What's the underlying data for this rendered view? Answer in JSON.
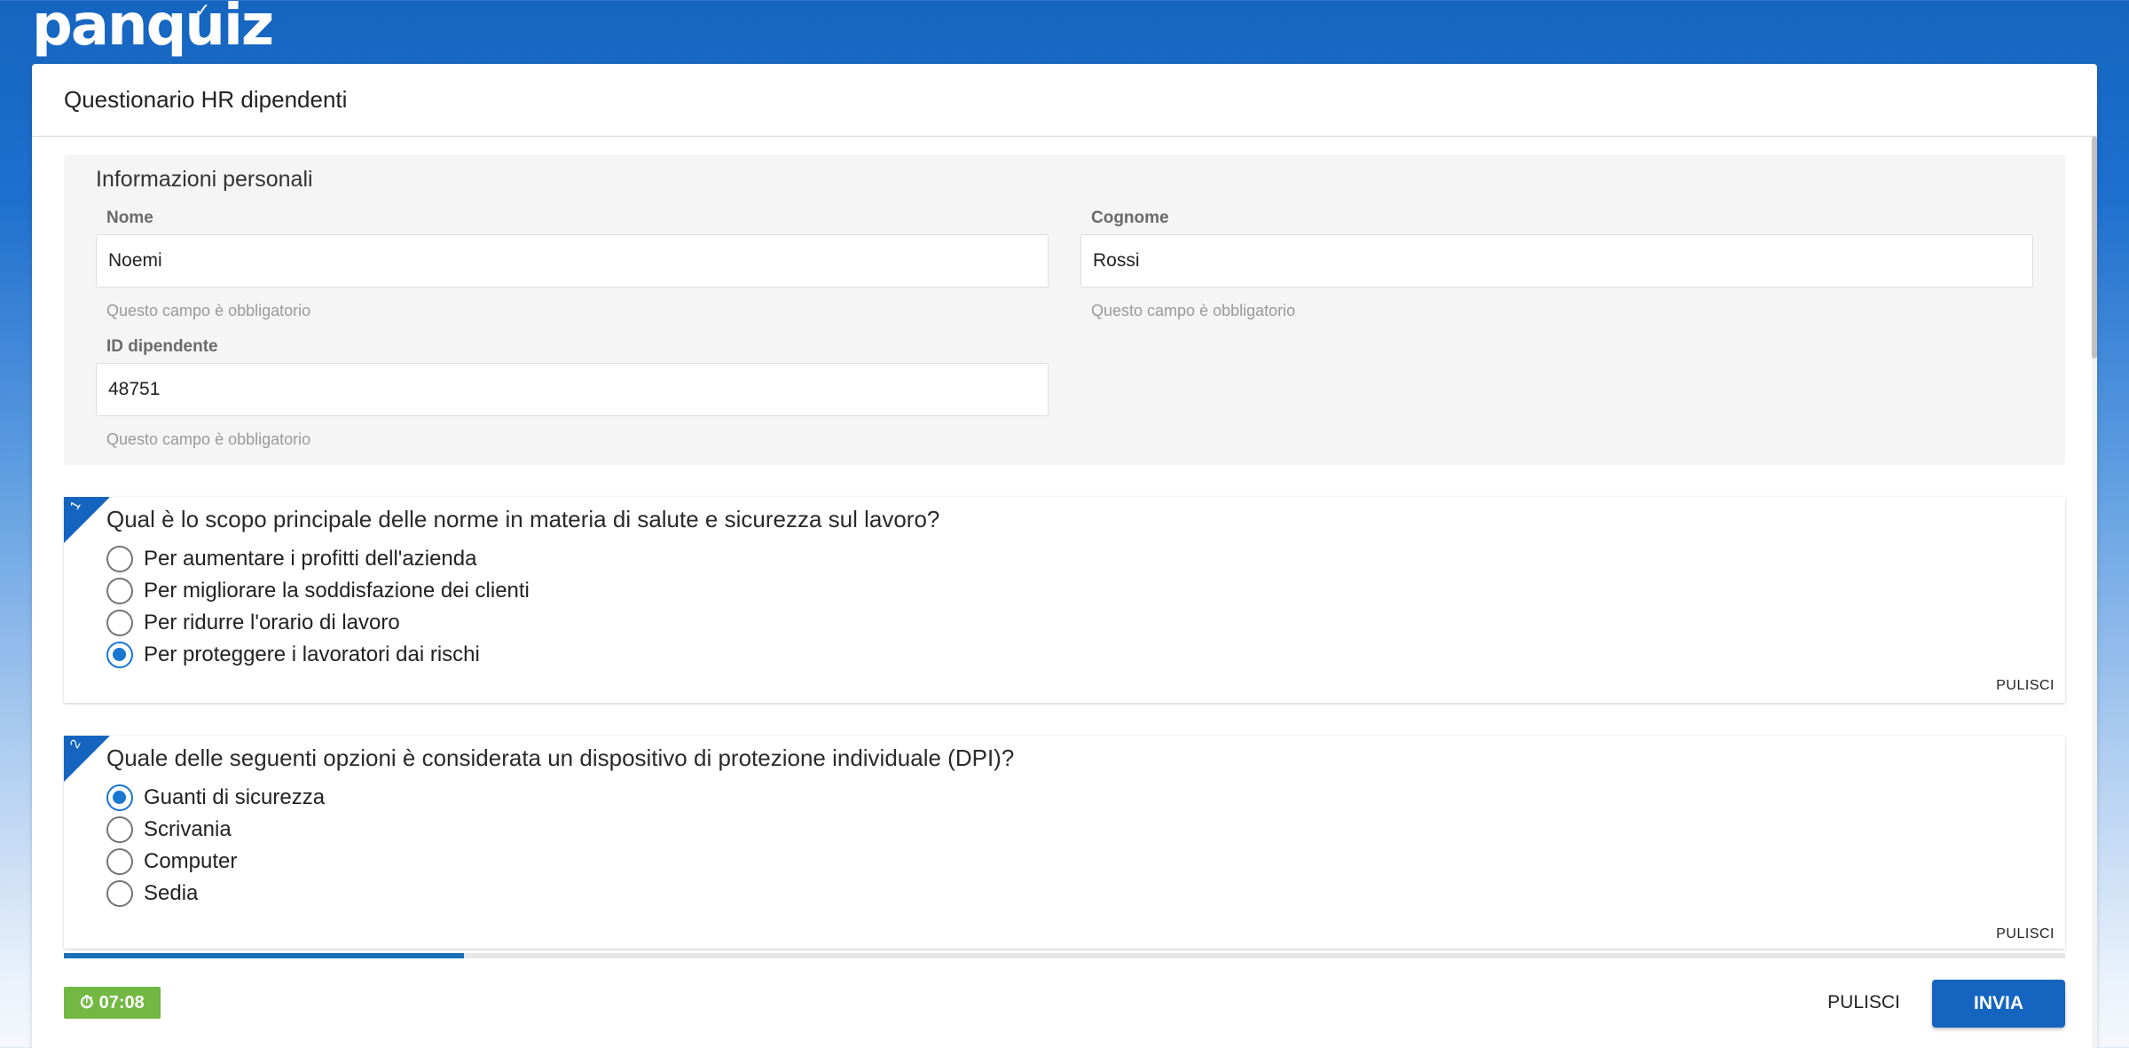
{
  "brand": {
    "logo_text": "panquiz",
    "logo_check": "✓"
  },
  "quiz": {
    "title": "Questionario HR dipendenti"
  },
  "personal_info": {
    "title": "Informazioni personali",
    "fields": [
      {
        "label": "Nome",
        "value": "Noemi",
        "hint": "Questo campo è obbligatorio"
      },
      {
        "label": "Cognome",
        "value": "Rossi",
        "hint": "Questo campo è obbligatorio"
      },
      {
        "label": "ID dipendente",
        "value": "48751",
        "hint": "Questo campo è obbligatorio"
      }
    ]
  },
  "questions": [
    {
      "number": "1",
      "text": "Qual è lo scopo principale delle norme in materia di salute e sicurezza sul lavoro?",
      "options": [
        {
          "label": "Per aumentare i profitti dell'azienda",
          "selected": false
        },
        {
          "label": "Per migliorare la soddisfazione dei clienti",
          "selected": false
        },
        {
          "label": "Per ridurre l'orario di lavoro",
          "selected": false
        },
        {
          "label": "Per proteggere i lavoratori dai rischi",
          "selected": true
        }
      ],
      "clear_label": "PULISCI"
    },
    {
      "number": "2",
      "text": "Quale delle seguenti opzioni è considerata un dispositivo di protezione individuale (DPI)?",
      "options": [
        {
          "label": "Guanti di sicurezza",
          "selected": true
        },
        {
          "label": "Scrivania",
          "selected": false
        },
        {
          "label": "Computer",
          "selected": false
        },
        {
          "label": "Sedia",
          "selected": false
        }
      ],
      "clear_label": "PULISCI"
    }
  ],
  "progress": {
    "fraction": 0.2
  },
  "footer": {
    "timer": "07:08",
    "timer_icon": "stopwatch-icon",
    "clear_label": "PULISCI",
    "submit_label": "INVIA"
  },
  "colors": {
    "primary": "#1565c0",
    "radio_selected": "#1976d2",
    "timer_bg": "#72b843"
  }
}
